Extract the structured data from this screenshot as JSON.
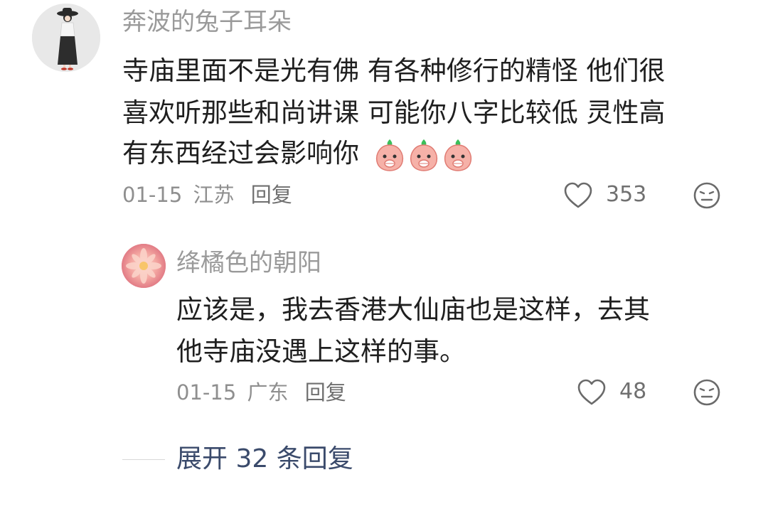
{
  "comment": {
    "username": "奔波的兔子耳朵",
    "lines": [
      "寺庙里面不是光有佛 有各种修行的精怪 他们很",
      "喜欢听那些和尚讲课 可能你八字比较低 灵性高",
      "有东西经过会影响你"
    ],
    "emoji_name": "peach-face-emoji",
    "date": "01-15",
    "location": "江苏",
    "reply_label": "回复",
    "like_count": "353"
  },
  "reply": {
    "username": "绛橘色的朝阳",
    "lines": [
      "应该是，我去香港大仙庙也是这样，去其",
      "他寺庙没遇上这样的事。"
    ],
    "date": "01-15",
    "location": "广东",
    "reply_label": "回复",
    "like_count": "48"
  },
  "expand": {
    "label": "展开 32 条回复"
  },
  "colors": {
    "username": "#9a9a9a",
    "meta": "#8f8f8f",
    "expand": "#3a4a6b"
  }
}
